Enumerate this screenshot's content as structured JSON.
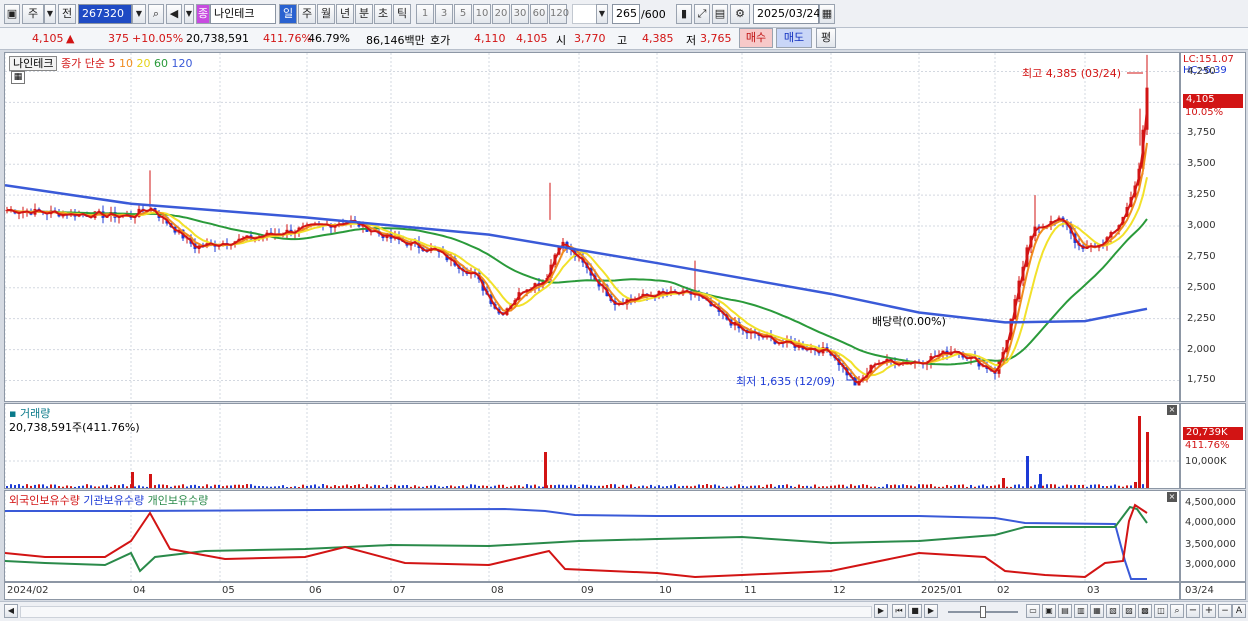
{
  "toolbar": {
    "market": "주",
    "prev": "전",
    "code": "267320",
    "type_badge": "종",
    "name": "나인테크",
    "periods": [
      "일",
      "주",
      "월",
      "년",
      "분",
      "초",
      "틱"
    ],
    "active_period": "일",
    "minutes": [
      "1",
      "3",
      "5",
      "10",
      "20",
      "30",
      "60",
      "120"
    ],
    "count": "265",
    "count_total": "/600",
    "date": "2025/03/24"
  },
  "quote": {
    "price": "4,105",
    "arrow": "▲",
    "change": "375",
    "change_pct": "+10.05%",
    "volume": "20,738,591",
    "vol_ratio": "411.76%",
    "turnover_ratio": "46.79%",
    "amount": "86,146백만",
    "ask_label": "호가",
    "ask1": "4,110",
    "ask2": "4,105",
    "open_label": "시",
    "open": "3,770",
    "high_label": "고",
    "high": "4,385",
    "low_label": "저",
    "low": "3,765",
    "buy": "매수",
    "sell": "매도",
    "eval": "평"
  },
  "price_panel": {
    "name_label": "나인테크",
    "ma_label": "종가 단순",
    "ma_periods": [
      "5",
      "10",
      "20",
      "60",
      "120"
    ],
    "lc": "LC:151.07",
    "hc": "HC:-6.39",
    "y_ticks": [
      "4,250",
      "4,000",
      "3,750",
      "3,500",
      "3,250",
      "3,000",
      "2,750",
      "2,500",
      "2,250",
      "2,000",
      "1,750"
    ],
    "last_price": "4,105",
    "last_pct": "10.05%",
    "high_note": "최고 4,385 (03/24)",
    "low_note": "최저 1,635 (12/09)",
    "dividend_note": "배당락(0.00%)"
  },
  "volume_panel": {
    "label": "거래량",
    "value": "20,738,591주(411.76%)",
    "tick": "10,000K",
    "last_badge": "20,739K",
    "last_pct": "411.76%"
  },
  "holdings_panel": {
    "foreign": "외국인보유수량",
    "inst": "기관보유수량",
    "indiv": "개인보유수량",
    "y_ticks": [
      "4,500,000",
      "4,000,000",
      "3,500,000",
      "3,000,000"
    ]
  },
  "x_axis": [
    "2024/02",
    "04",
    "05",
    "06",
    "07",
    "08",
    "09",
    "10",
    "11",
    "12",
    "2025/01",
    "02",
    "03"
  ],
  "x_right": "03/24",
  "colors": {
    "up": "#d21414",
    "down": "#1c3ad6",
    "ma5": "#d21414",
    "ma10": "#f08c1e",
    "ma20": "#f2e12a",
    "ma60": "#2a9a3a",
    "ma120": "#3a5ad8"
  },
  "chart_data": {
    "type": "candlestick",
    "period": "daily",
    "start": "2024/02",
    "end": "2025/03/24",
    "high": {
      "value": 4385,
      "date": "03/24"
    },
    "low": {
      "value": 1635,
      "date": "12/09"
    },
    "last": 4105,
    "ylim": [
      1600,
      4400
    ]
  }
}
